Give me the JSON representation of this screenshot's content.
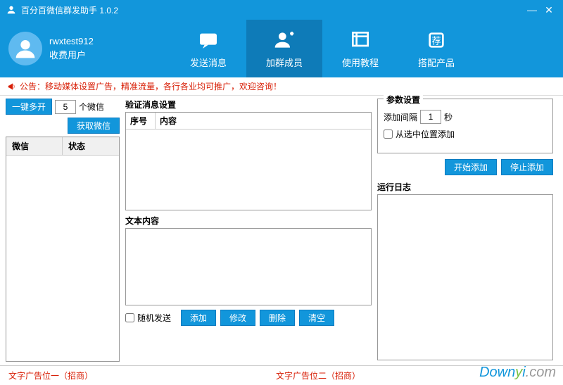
{
  "title": "百分百微信群发助手 1.0.2",
  "user": {
    "name": "rwxtest912",
    "type": "收费用户"
  },
  "nav": [
    {
      "label": "发送消息",
      "icon": "chat"
    },
    {
      "label": "加群成员",
      "icon": "add-user",
      "active": true
    },
    {
      "label": "使用教程",
      "icon": "tutorial"
    },
    {
      "label": "搭配产品",
      "icon": "product"
    }
  ],
  "announce": "公告：移动媒体设置广告，精准流量，各行各业均可推广，欢迎咨询！",
  "left": {
    "multi_open_btn": "一键多开",
    "multi_open_count": "5",
    "multi_open_suffix": "个微信",
    "get_wechat_btn": "获取微信",
    "table_cols": [
      "微信",
      "状态"
    ]
  },
  "mid": {
    "verify_title": "验证消息设置",
    "verify_cols": [
      "序号",
      "内容"
    ],
    "text_title": "文本内容",
    "random_send": "随机发送",
    "btns": [
      "添加",
      "修改",
      "删除",
      "清空"
    ]
  },
  "right": {
    "param_title": "参数设置",
    "interval_label": "添加间隔",
    "interval_value": "1",
    "interval_unit": "秒",
    "from_selected": "从选中位置添加",
    "start_btn": "开始添加",
    "stop_btn": "停止添加",
    "log_title": "运行日志"
  },
  "footer": {
    "ad1": "文字广告位一（招商）",
    "ad2": "文字广告位二（招商）"
  },
  "watermark": {
    "a": "Down",
    "b": "y",
    "c": "i",
    "d": ".com"
  }
}
